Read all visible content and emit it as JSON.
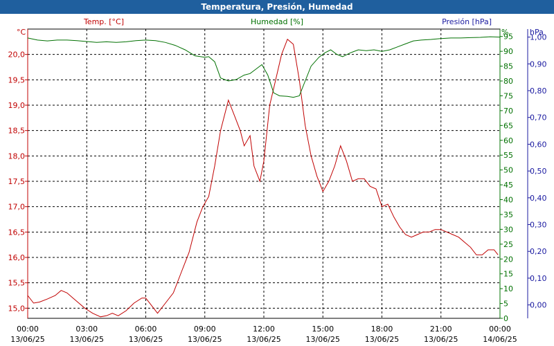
{
  "window": {
    "title": "Temperatura, Presión, Humedad"
  },
  "colors": {
    "temp": "#c00000",
    "humidity": "#007000",
    "pressure": "#1a1aa0",
    "grid": "#000000"
  },
  "chart_data": {
    "type": "line",
    "title": "Temperatura, Presión, Humedad",
    "legend_labels": {
      "temp": "Temp. [°C]",
      "humidity": "Humedad [%]",
      "pressure": "Presión [hPa]"
    },
    "axis_units": {
      "temp": "°C",
      "humidity": "%",
      "pressure": "hPa"
    },
    "grid": true,
    "x_ticks": [
      {
        "time": "00:00",
        "date": "13/06/25"
      },
      {
        "time": "03:00",
        "date": "13/06/25"
      },
      {
        "time": "06:00",
        "date": "13/06/25"
      },
      {
        "time": "09:00",
        "date": "13/06/25"
      },
      {
        "time": "12:00",
        "date": "13/06/25"
      },
      {
        "time": "15:00",
        "date": "13/06/25"
      },
      {
        "time": "18:00",
        "date": "13/06/25"
      },
      {
        "time": "21:00",
        "date": "13/06/25"
      },
      {
        "time": "00:00",
        "date": "14/06/25"
      }
    ],
    "x_range_hours": [
      0,
      24
    ],
    "temp_axis": {
      "range": [
        14.8,
        20.5
      ],
      "ticks": [
        "20,0",
        "19,5",
        "19,0",
        "18,5",
        "18,0",
        "17,5",
        "17,0",
        "16,5",
        "16,0",
        "15,5",
        "15,0"
      ],
      "tick_values": [
        20.0,
        19.5,
        19.0,
        18.5,
        18.0,
        17.5,
        17.0,
        16.5,
        16.0,
        15.5,
        15.0
      ]
    },
    "humidity_axis": {
      "range": [
        0,
        97.5
      ],
      "ticks": [
        "95",
        "90",
        "85",
        "80",
        "75",
        "70",
        "65",
        "60",
        "55",
        "50",
        "45",
        "40",
        "35",
        "30",
        "25",
        "20",
        "15",
        "10",
        "5",
        "0"
      ],
      "tick_values": [
        95,
        90,
        85,
        80,
        75,
        70,
        65,
        60,
        55,
        50,
        45,
        40,
        35,
        30,
        25,
        20,
        15,
        10,
        5,
        0
      ]
    },
    "pressure_axis": {
      "range": [
        -0.05,
        1.03
      ],
      "ticks": [
        "1,00",
        "0,90",
        "0,80",
        "0,70",
        "0,60",
        "0,50",
        "0,40",
        "0,30",
        "0,20",
        "0,10",
        "0,00"
      ],
      "tick_values": [
        1.0,
        0.9,
        0.8,
        0.7,
        0.6,
        0.5,
        0.4,
        0.3,
        0.2,
        0.1,
        0.0
      ]
    },
    "series": [
      {
        "name": "Temp. [°C]",
        "axis": "temp",
        "points": [
          [
            0.0,
            15.25
          ],
          [
            0.3,
            15.1
          ],
          [
            0.6,
            15.12
          ],
          [
            1.0,
            15.18
          ],
          [
            1.4,
            15.25
          ],
          [
            1.7,
            15.35
          ],
          [
            2.0,
            15.3
          ],
          [
            2.3,
            15.2
          ],
          [
            2.6,
            15.1
          ],
          [
            2.9,
            15.0
          ],
          [
            3.3,
            14.9
          ],
          [
            3.7,
            14.83
          ],
          [
            4.0,
            14.85
          ],
          [
            4.3,
            14.9
          ],
          [
            4.6,
            14.85
          ],
          [
            5.0,
            14.95
          ],
          [
            5.4,
            15.1
          ],
          [
            5.8,
            15.2
          ],
          [
            6.0,
            15.2
          ],
          [
            6.3,
            15.05
          ],
          [
            6.6,
            14.9
          ],
          [
            7.0,
            15.1
          ],
          [
            7.4,
            15.3
          ],
          [
            7.8,
            15.7
          ],
          [
            8.2,
            16.1
          ],
          [
            8.6,
            16.7
          ],
          [
            8.9,
            17.0
          ],
          [
            9.2,
            17.2
          ],
          [
            9.5,
            17.8
          ],
          [
            9.8,
            18.5
          ],
          [
            10.2,
            19.1
          ],
          [
            10.5,
            18.8
          ],
          [
            10.8,
            18.5
          ],
          [
            11.0,
            18.2
          ],
          [
            11.3,
            18.4
          ],
          [
            11.5,
            17.8
          ],
          [
            11.8,
            17.5
          ],
          [
            12.0,
            17.9
          ],
          [
            12.3,
            19.0
          ],
          [
            12.6,
            19.5
          ],
          [
            12.9,
            20.0
          ],
          [
            13.2,
            20.3
          ],
          [
            13.5,
            20.2
          ],
          [
            13.8,
            19.5
          ],
          [
            14.1,
            18.6
          ],
          [
            14.4,
            18.0
          ],
          [
            14.7,
            17.6
          ],
          [
            15.0,
            17.3
          ],
          [
            15.3,
            17.5
          ],
          [
            15.6,
            17.8
          ],
          [
            15.9,
            18.2
          ],
          [
            16.2,
            17.9
          ],
          [
            16.5,
            17.5
          ],
          [
            16.8,
            17.55
          ],
          [
            17.1,
            17.55
          ],
          [
            17.4,
            17.4
          ],
          [
            17.7,
            17.35
          ],
          [
            18.0,
            17.0
          ],
          [
            18.3,
            17.05
          ],
          [
            18.6,
            16.8
          ],
          [
            18.9,
            16.6
          ],
          [
            19.2,
            16.45
          ],
          [
            19.5,
            16.4
          ],
          [
            19.8,
            16.45
          ],
          [
            20.1,
            16.5
          ],
          [
            20.4,
            16.5
          ],
          [
            20.7,
            16.55
          ],
          [
            21.0,
            16.55
          ],
          [
            21.3,
            16.5
          ],
          [
            21.6,
            16.45
          ],
          [
            21.9,
            16.4
          ],
          [
            22.2,
            16.3
          ],
          [
            22.5,
            16.2
          ],
          [
            22.8,
            16.05
          ],
          [
            23.1,
            16.05
          ],
          [
            23.4,
            16.15
          ],
          [
            23.7,
            16.15
          ],
          [
            23.9,
            16.05
          ]
        ]
      },
      {
        "name": "Humedad [%]",
        "axis": "humidity",
        "points": [
          [
            0.0,
            94.5
          ],
          [
            0.5,
            93.8
          ],
          [
            1.0,
            93.5
          ],
          [
            1.5,
            93.8
          ],
          [
            2.0,
            93.8
          ],
          [
            2.5,
            93.6
          ],
          [
            3.0,
            93.3
          ],
          [
            3.5,
            93.0
          ],
          [
            4.0,
            93.2
          ],
          [
            4.5,
            93.0
          ],
          [
            5.0,
            93.2
          ],
          [
            5.5,
            93.6
          ],
          [
            6.0,
            93.8
          ],
          [
            6.5,
            93.6
          ],
          [
            7.0,
            93.0
          ],
          [
            7.5,
            92.0
          ],
          [
            8.0,
            90.5
          ],
          [
            8.5,
            88.5
          ],
          [
            9.0,
            88.0
          ],
          [
            9.2,
            88.2
          ],
          [
            9.5,
            86.5
          ],
          [
            9.8,
            81.0
          ],
          [
            10.2,
            80.0
          ],
          [
            10.6,
            80.5
          ],
          [
            11.0,
            82.0
          ],
          [
            11.3,
            82.5
          ],
          [
            11.6,
            84.0
          ],
          [
            11.9,
            85.5
          ],
          [
            12.2,
            82.0
          ],
          [
            12.5,
            76.0
          ],
          [
            12.8,
            75.0
          ],
          [
            13.2,
            74.8
          ],
          [
            13.5,
            74.5
          ],
          [
            13.8,
            75.0
          ],
          [
            14.1,
            80.0
          ],
          [
            14.4,
            85.0
          ],
          [
            14.8,
            88.0
          ],
          [
            15.1,
            89.5
          ],
          [
            15.4,
            90.5
          ],
          [
            15.7,
            89.0
          ],
          [
            16.0,
            88.2
          ],
          [
            16.4,
            89.5
          ],
          [
            16.8,
            90.5
          ],
          [
            17.2,
            90.2
          ],
          [
            17.6,
            90.5
          ],
          [
            18.0,
            90.0
          ],
          [
            18.4,
            90.5
          ],
          [
            18.8,
            91.5
          ],
          [
            19.2,
            92.5
          ],
          [
            19.6,
            93.5
          ],
          [
            20.0,
            93.8
          ],
          [
            20.5,
            94.0
          ],
          [
            21.0,
            94.3
          ],
          [
            21.5,
            94.5
          ],
          [
            22.0,
            94.5
          ],
          [
            22.5,
            94.6
          ],
          [
            23.0,
            94.7
          ],
          [
            23.5,
            94.9
          ],
          [
            24.0,
            94.8
          ]
        ]
      }
    ]
  }
}
